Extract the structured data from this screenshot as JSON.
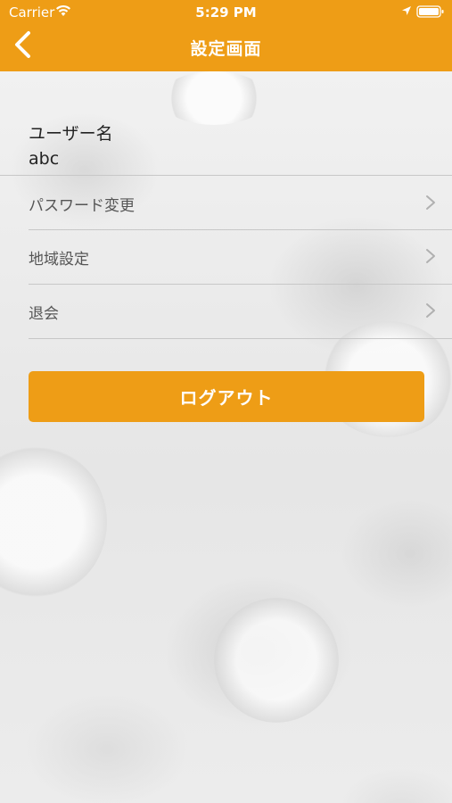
{
  "status_bar": {
    "carrier": "Carrier",
    "time": "5:29 PM"
  },
  "nav": {
    "title": "設定画面",
    "back_icon": "chevron-left-icon"
  },
  "user": {
    "label": "ユーザー名",
    "value": "abc"
  },
  "menu": {
    "items": [
      {
        "label": "パスワード変更",
        "icon": "chevron-right-icon"
      },
      {
        "label": "地域設定",
        "icon": "chevron-right-icon"
      },
      {
        "label": "退会",
        "icon": "chevron-right-icon"
      }
    ]
  },
  "logout": {
    "label": "ログアウト"
  },
  "colors": {
    "accent": "#ee9d16",
    "background": "#ededed"
  }
}
